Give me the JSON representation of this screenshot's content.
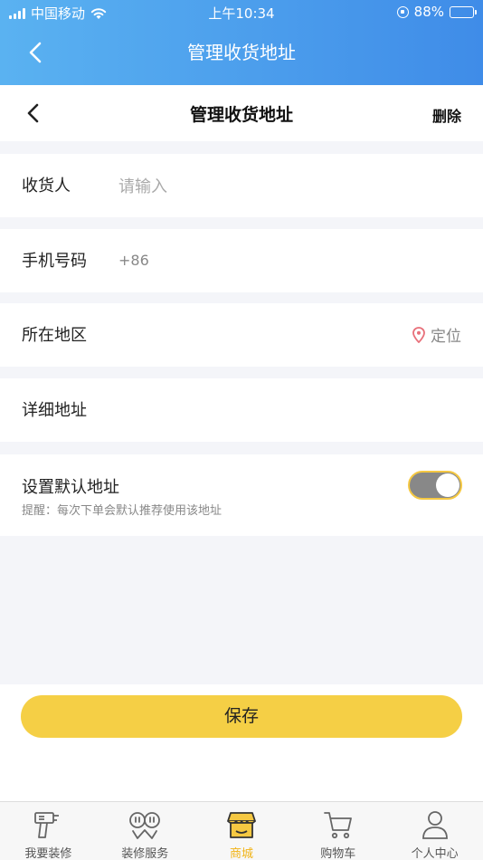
{
  "status_bar": {
    "carrier": "中国移动",
    "time": "上午10:34",
    "battery": "88%",
    "battery_level": 0.88
  },
  "outer_nav": {
    "title": "管理收货地址"
  },
  "inner_nav": {
    "title": "管理收货地址",
    "delete_label": "删除"
  },
  "form": {
    "receiver_label": "收货人",
    "receiver_placeholder": "请输入",
    "phone_label": "手机号码",
    "phone_prefix": "+86",
    "region_label": "所在地区",
    "locate_label": "定位",
    "detail_label": "详细地址",
    "default_label": "设置默认地址",
    "default_hint": "提醒：每次下单会默认推荐使用该地址",
    "default_on": true
  },
  "save_label": "保存",
  "tabs": [
    {
      "label": "我要装修",
      "icon": "drill-icon",
      "active": false
    },
    {
      "label": "装修服务",
      "icon": "service-icon",
      "active": false
    },
    {
      "label": "商城",
      "icon": "shop-icon",
      "active": true
    },
    {
      "label": "购物车",
      "icon": "cart-icon",
      "active": false
    },
    {
      "label": "个人中心",
      "icon": "user-icon",
      "active": false
    }
  ],
  "colors": {
    "header_gradient_start": "#5ab2f1",
    "header_gradient_end": "#3f8ce8",
    "accent_yellow": "#f5cf45",
    "active_tab": "#f1b418",
    "location_pin": "#e8707a"
  }
}
